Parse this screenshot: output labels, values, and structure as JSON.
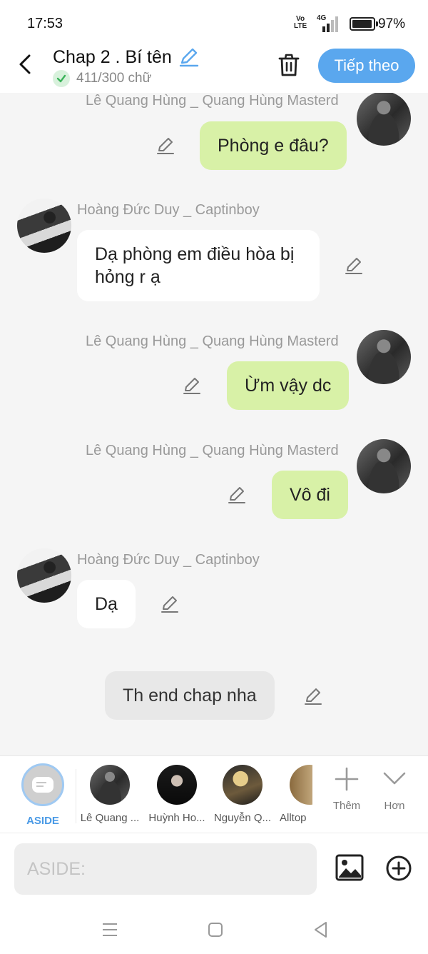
{
  "status_bar": {
    "time": "17:53",
    "volte": "Vo\nLTE",
    "network": "4G",
    "battery": "97%"
  },
  "header": {
    "title": "Chap 2 . Bí tên",
    "word_count": "411/300 chữ",
    "next_button": "Tiếp theo"
  },
  "messages": [
    {
      "side": "right",
      "sender": "Lê Quang Hùng _ Quang Hùng Masterd",
      "text": "Phòng e đâu?"
    },
    {
      "side": "left",
      "sender": "Hoàng Đức Duy _ Captinboy",
      "text": "Dạ phòng em điều hòa bị hỏng r ạ"
    },
    {
      "side": "right",
      "sender": "Lê Quang Hùng _ Quang Hùng Masterd",
      "text": "Ừm vậy dc"
    },
    {
      "side": "right",
      "sender": "Lê Quang Hùng _ Quang Hùng Masterd",
      "text": "Vô đi"
    },
    {
      "side": "left",
      "sender": "Hoàng Đức Duy _ Captinboy",
      "text": "Dạ"
    },
    {
      "side": "center",
      "sender": "",
      "text": "Th end chap nha"
    }
  ],
  "characters": [
    {
      "label": "ASIDE",
      "active": true
    },
    {
      "label": "Lê Quang ..."
    },
    {
      "label": "Huỳnh Ho..."
    },
    {
      "label": "Nguyễn Q..."
    },
    {
      "label": "Alltop"
    }
  ],
  "char_actions": {
    "add": "Thêm",
    "more": "Hơn"
  },
  "input": {
    "placeholder": "ASIDE:"
  },
  "colors": {
    "accent": "#5aa7ee",
    "right_bubble": "#d8f1a7",
    "left_bubble": "#ffffff",
    "aside_bubble": "#e8e8e8"
  }
}
